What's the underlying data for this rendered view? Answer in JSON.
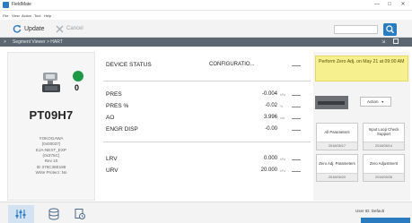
{
  "window": {
    "title": "FieldMate"
  },
  "menu": [
    "File",
    "View",
    "Action",
    "Tool",
    "Help"
  ],
  "toolbar": {
    "update_label": "Update",
    "cancel_label": "Cancel",
    "search_value": ""
  },
  "breadcrumb": "Segment Viewer > HART",
  "device": {
    "status_count": "0",
    "tag": "PT09H7",
    "info": [
      "YOKOGAWA",
      "(0x00037)",
      "EJA-NEXT_EXP",
      "(0x375C)",
      "Rev 10",
      "ID 375C36E188",
      "Write Protect :No"
    ]
  },
  "params": {
    "status": {
      "label": "DEVICE STATUS",
      "value": "CONFIGURATIO..."
    },
    "pres": {
      "label": "PRES",
      "value": "-0.004",
      "unit": "kPa"
    },
    "pres_pct": {
      "label": "PRES %",
      "value": "-0.02",
      "unit": "%"
    },
    "ao": {
      "label": "AO",
      "value": "3.996",
      "unit": "mA"
    },
    "engr": {
      "label": "ENGR DISP",
      "value": "-0.00"
    },
    "lrv": {
      "label": "LRV",
      "value": "0.000",
      "unit": "kPa"
    },
    "urv": {
      "label": "URV",
      "value": "20.000",
      "unit": "kPa"
    }
  },
  "alert": "Perform Zero Adj. on May 21 at 09:00 AM",
  "actions_label": "Action",
  "tiles": [
    {
      "label": "All Parameters",
      "date": "2016/06/17"
    },
    {
      "label": "Input Loop Check Support",
      "date": "2016/05/14"
    },
    {
      "label": "Zero Adj. Parameters",
      "date": "2016/05/20"
    },
    {
      "label": "Zero Adjustment",
      "date": "2016/05/26"
    }
  ],
  "footer": {
    "user": "User ID: Default"
  },
  "colors": {
    "accent": "#2a7bc0",
    "status_ok": "#1e9a47",
    "alert_bg": "#f7f08e",
    "breadcrumb_bg": "#5b6670"
  },
  "icons": [
    "app-icon",
    "update-icon",
    "cancel-icon",
    "search-icon",
    "device-icon",
    "equalizer-icon",
    "cylinder-icon",
    "history-icon"
  ]
}
